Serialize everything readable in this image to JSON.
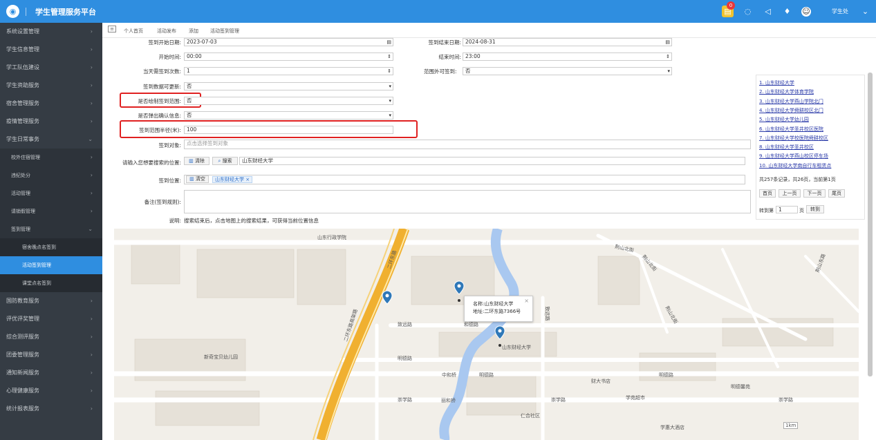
{
  "app": {
    "title": "学生管理服务平台",
    "badge": "0",
    "user": "学生处"
  },
  "sidebar": {
    "items": [
      {
        "label": "系统设置管理",
        "arrow": "›",
        "level": 0
      },
      {
        "label": "学生信息管理",
        "arrow": "›",
        "level": 0
      },
      {
        "label": "学工队伍建设",
        "arrow": "›",
        "level": 0
      },
      {
        "label": "学生资助服务",
        "arrow": "›",
        "level": 0
      },
      {
        "label": "宿舍管理服务",
        "arrow": "›",
        "level": 0
      },
      {
        "label": "疫情管理服务",
        "arrow": "›",
        "level": 0
      },
      {
        "label": "学生日常事务",
        "arrow": "⌄",
        "level": 0
      },
      {
        "label": "校外住宿管理",
        "arrow": "›",
        "level": 1
      },
      {
        "label": "违纪处分",
        "arrow": "›",
        "level": 1
      },
      {
        "label": "活动管理",
        "arrow": "›",
        "level": 1
      },
      {
        "label": "请销假管理",
        "arrow": "›",
        "level": 1
      },
      {
        "label": "签到管理",
        "arrow": "⌄",
        "level": 1
      },
      {
        "label": "宿舍晚点名签到",
        "arrow": "",
        "level": 2
      },
      {
        "label": "活动签到管理",
        "arrow": "",
        "level": 2,
        "active": true
      },
      {
        "label": "课堂点名签到",
        "arrow": "",
        "level": 2
      },
      {
        "label": "国防教育服务",
        "arrow": "›",
        "level": 0
      },
      {
        "label": "评优评奖管理",
        "arrow": "›",
        "level": 0
      },
      {
        "label": "综合测评服务",
        "arrow": "›",
        "level": 0
      },
      {
        "label": "团委管理服务",
        "arrow": "›",
        "level": 0
      },
      {
        "label": "通知新闻服务",
        "arrow": "›",
        "level": 0
      },
      {
        "label": "心理健康服务",
        "arrow": "›",
        "level": 0
      },
      {
        "label": "统计报表服务",
        "arrow": "›",
        "level": 0
      }
    ]
  },
  "breadcrumb": [
    "个人首页",
    "活动发布",
    "添加",
    "活动签到管理"
  ],
  "form": {
    "start_date_label": "签到开始日期:",
    "start_date": "2023-07-03",
    "end_date_label": "签到结束日期:",
    "end_date": "2024-08-31",
    "start_time_label": "开始时间:",
    "start_time": "00:00",
    "end_time_label": "结束时间:",
    "end_time": "23:00",
    "daily_count_label": "当天需签到次数:",
    "daily_count": "1",
    "outside_label": "范围外可签到:",
    "outside": "否",
    "updatable_label": "签到数据可更新:",
    "updatable": "否",
    "draw_range_label": "是否绘制签到范围:",
    "draw_range": "否",
    "confirm_label": "是否弹出确认信息:",
    "confirm": "否",
    "radius_label": "签到范围半径(米):",
    "radius": "100",
    "target_label": "签到对象:",
    "target_placeholder": "点击选择签到对象",
    "search_label": "请输入您想要搜索的位置:",
    "clear": "清除",
    "search": "搜索",
    "search_value": "山东财经大学",
    "location_label": "签到位置:",
    "clear2": "清空",
    "location_tag": "山东财经大学 ×",
    "remark_label": "备注(签到规则):",
    "note_label": "说明:",
    "note": "搜索结束后，点击地图上的搜索结果，可获得当前位置信息"
  },
  "results": {
    "items": [
      "1. 山东财经大学",
      "2. 山东财经大学体育学院",
      "3. 山东财经大学燕山学院北门",
      "4. 山东财经大学舜耕校区北门",
      "5. 山东财经大学幼儿园",
      "6. 山东财经大学圣井校区医院",
      "7. 山东财经大学校医院舜耕校区",
      "8. 山东财经大学圣井校区",
      "9. 山东财经大学燕山校区停车场",
      "10. 山东财经大学南自行车租赁点"
    ],
    "summary": "共257条记录，共26页，当前第1页",
    "first": "首页",
    "prev": "上一页",
    "next": "下一页",
    "last": "尾页",
    "jump_pre": "转到第",
    "jump_val": "1",
    "jump_post": "页",
    "jump_btn": "转到"
  },
  "map": {
    "labels": [
      "山东行政学院",
      "二环东路",
      "二环东路高架路",
      "致远路",
      "明德路",
      "中和桥",
      "明德路",
      "财大书店",
      "明德路",
      "明德馨苑",
      "崇学路",
      "丽和桥",
      "崇学路",
      "学苑超市",
      "崇学路",
      "仁合社区",
      "学惠大酒店",
      "新奇宝贝幼儿园",
      "荆山北街",
      "荆山北街",
      "荆山北街",
      "荆山东路",
      "致远路",
      "和德路",
      "山东财经大学"
    ],
    "popup_name": "名称:山东财经大学",
    "popup_addr": "地址:二环东路7366号",
    "popup_close": "×",
    "scale": "1km"
  }
}
